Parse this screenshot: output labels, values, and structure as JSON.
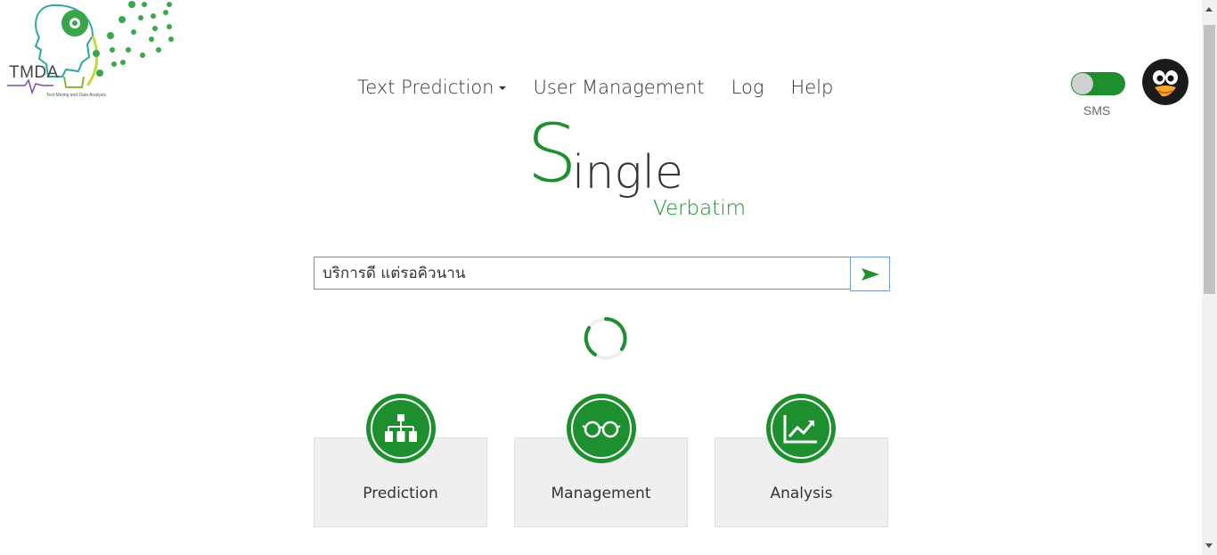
{
  "logo": {
    "text": "TMDA",
    "subtitle": "Text Mining and Data Analysis"
  },
  "nav": {
    "items": [
      {
        "label": "Text Prediction",
        "dropdown": true
      },
      {
        "label": "User Management"
      },
      {
        "label": "Log"
      },
      {
        "label": "Help"
      }
    ]
  },
  "toggle": {
    "label": "SMS",
    "state": "on"
  },
  "hero": {
    "title_first": "S",
    "title_rest": "ingle",
    "subtitle": "Verbatim"
  },
  "search": {
    "value": "บริการดี แต่รอคิวนาน",
    "send_icon": "send-arrow-icon"
  },
  "cards": [
    {
      "label": "Prediction",
      "icon": "hierarchy-icon"
    },
    {
      "label": "Management",
      "icon": "glasses-icon"
    },
    {
      "label": "Analysis",
      "icon": "chart-trend-icon"
    }
  ],
  "colors": {
    "brand_green": "#1e8f2e",
    "card_bg": "#efefef",
    "text": "#333333"
  }
}
